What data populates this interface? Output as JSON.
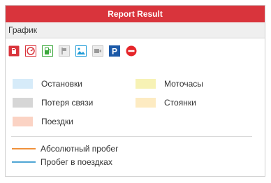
{
  "window": {
    "title": "Report Result"
  },
  "section": {
    "title": "График"
  },
  "toolbar": {
    "buttons": [
      {
        "icon": "fuel-icon"
      },
      {
        "icon": "speedometer-icon"
      },
      {
        "icon": "fuel-station-icon"
      },
      {
        "icon": "flag-icon"
      },
      {
        "icon": "image-icon"
      },
      {
        "icon": "video-icon"
      },
      {
        "icon": "parking-icon"
      },
      {
        "icon": "no-entry-icon"
      }
    ]
  },
  "legend": {
    "stops": {
      "label": "Остановки",
      "color": "#d6ebf9"
    },
    "engine_hours": {
      "label": "Моточасы",
      "color": "#f7f2b5"
    },
    "connection_loss": {
      "label": "Потеря связи",
      "color": "#d6d6d6"
    },
    "parkings": {
      "label": "Стоянки",
      "color": "#fdebc2"
    },
    "trips": {
      "label": "Поездки",
      "color": "#fbd3c4"
    }
  },
  "lines": {
    "absolute_mileage": {
      "label": "Абсолютный пробег",
      "color": "#f0913b"
    },
    "trip_mileage": {
      "label": "Пробег в поездках",
      "color": "#4fa6d4"
    }
  }
}
